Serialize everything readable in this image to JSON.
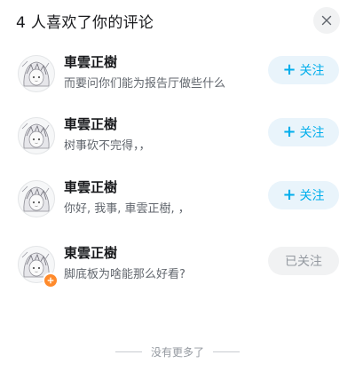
{
  "header": {
    "title": "4 人喜欢了你的评论",
    "close_icon": "close-icon"
  },
  "users": [
    {
      "name": "車雲正樹",
      "comment": "而要问你们能为报告厅做些什么",
      "button": {
        "plus": "+",
        "label": "关注",
        "state": "follow"
      }
    },
    {
      "name": "車雲正樹",
      "comment": "树事砍不完得，，",
      "button": {
        "plus": "+",
        "label": "关注",
        "state": "follow"
      }
    },
    {
      "name": "車雲正樹",
      "comment": "你好, 我事, 車雲正樹, ，",
      "button": {
        "plus": "+",
        "label": "关注",
        "state": "follow"
      }
    },
    {
      "name": "東雲正樹",
      "comment": "脚底板为啥能那么好看?",
      "button": {
        "plus": "",
        "label": "已关注",
        "state": "followed"
      },
      "badge_icon": "flower-badge-icon"
    }
  ],
  "footer": {
    "text": "没有更多了"
  },
  "colors": {
    "accent": "#00aeec",
    "accent_bg": "#e9f4fb",
    "followed_bg": "#f1f2f3",
    "followed_text": "#9499a0",
    "badge": "#ff8a2b"
  }
}
